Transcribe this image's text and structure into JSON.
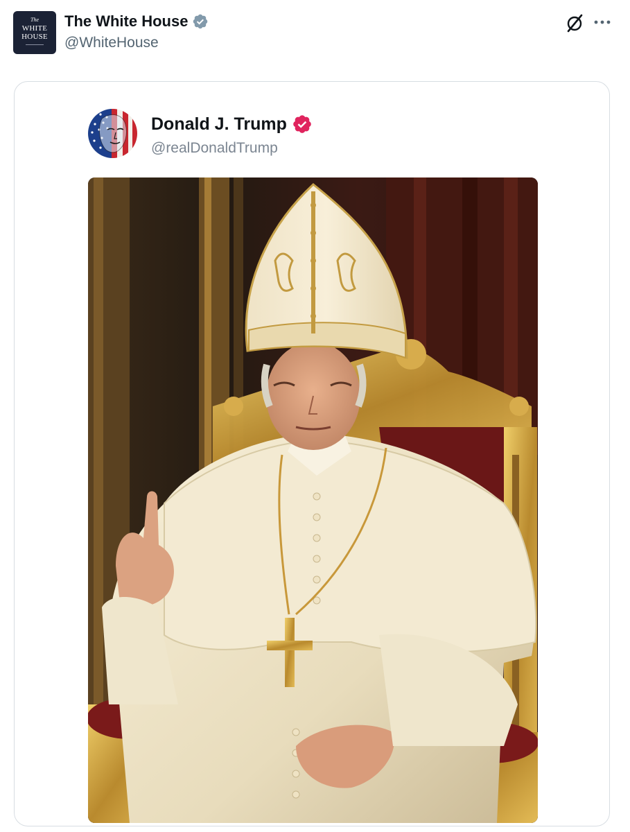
{
  "tweet": {
    "author": {
      "name": "The White House",
      "handle": "@WhiteHouse",
      "verified": true,
      "badge_color": "#829aab",
      "avatar_text": {
        "line1": "The",
        "line2": "WHITE",
        "line3": "HOUSE"
      }
    },
    "actions": {
      "grok_icon": "grok-slash-circle-icon",
      "more_icon": "more-horizontal-icon"
    }
  },
  "quoted_post": {
    "author": {
      "name": "Donald J. Trump",
      "handle": "@realDonaldTrump",
      "verified": true,
      "badge_color": "#e0245e"
    },
    "image": {
      "kind": "photo",
      "subject": "man in white papal vestments and gold-embroidered mitre seated on gilded throne, right index finger raised, gold cross pendant"
    }
  },
  "colors": {
    "text_primary": "#0f1419",
    "text_secondary": "#536471",
    "card_border": "#d7dde2",
    "avatar_bg": "#1b2235"
  }
}
